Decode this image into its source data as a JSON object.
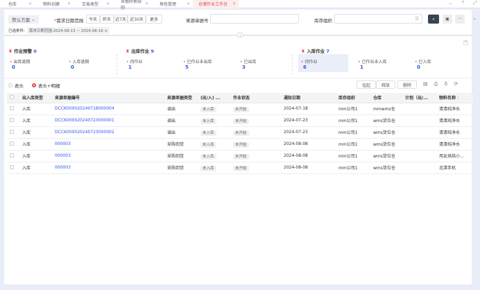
{
  "tabs": [
    {
      "label": "仓库"
    },
    {
      "label": "物料创建"
    },
    {
      "label": "交易类型"
    },
    {
      "label": "单据转换规则"
    },
    {
      "label": "角色管理"
    },
    {
      "label": "仓储作业工作台",
      "active": true
    }
  ],
  "filter": {
    "scheme": "默认方案",
    "date_label": "需求日期范围",
    "quick": [
      "今天",
      "昨天",
      "近7天",
      "近30天",
      "更多"
    ],
    "source_no_label": "来源单据号",
    "source_no_value": "",
    "org_label": "库存组织",
    "org_value": "",
    "selected_label": "已选条件:",
    "selected_tag": "需求日期范围:2024-08-13 ~ 2024-08-16"
  },
  "stats": {
    "warning": {
      "title": "作业预警",
      "count": "0",
      "items": [
        {
          "label": "出库逾期",
          "value": "0"
        },
        {
          "label": "入库逾期",
          "value": "0"
        }
      ]
    },
    "outbound": {
      "title": "出库作业",
      "count": "9",
      "items": [
        {
          "label": "待作业",
          "value": "1"
        },
        {
          "label": "已作业未出库",
          "value": "5"
        },
        {
          "label": "已出库",
          "value": "3"
        }
      ]
    },
    "inbound": {
      "title": "入库作业",
      "count": "7",
      "items": [
        {
          "label": "待作业",
          "value": "6"
        },
        {
          "label": "已作业未入库",
          "value": "1"
        },
        {
          "label": "已入库",
          "value": "0"
        }
      ]
    }
  },
  "view": {
    "options": [
      "表头",
      "表头+明细"
    ],
    "selected": 1
  },
  "actions": {
    "suspend": "挂起",
    "release": "释放",
    "delete": "删除"
  },
  "table": {
    "columns": [
      "出入库类型",
      "来源单据编号",
      "来源单据类型",
      "(出/入) ...",
      "作业状态",
      "通知日期",
      "库存组织",
      "仓库",
      "计划（出/...",
      "物料名称"
    ],
    "rows": [
      [
        "入库",
        "DCCK000020240718000004",
        "调出",
        "未入库",
        "未开始",
        "2024-07-18",
        "mm公司1",
        "mmwms仓",
        "",
        "清清纯净水"
      ],
      [
        "入库",
        "DCCK000020240723000001",
        "调出",
        "未入库",
        "未开始",
        "2024-07-23",
        "mm公司1",
        "wms货位仓",
        "",
        "清清纯净水"
      ],
      [
        "入库",
        "DCCK000020240723000002",
        "调出",
        "未入库",
        "未开始",
        "2024-07-23",
        "mm公司1",
        "wms货位仓",
        "",
        "清清纯净水"
      ],
      [
        "入库",
        "000003",
        "采购到货",
        "未入库",
        "未开始",
        "2024-08-08",
        "mm公司1",
        "wms货位仓",
        "",
        "清清纯净水"
      ],
      [
        "入库",
        "000003",
        "采购到货",
        "未入库",
        "未开始",
        "2024-08-08",
        "mm公司1",
        "wms货位仓",
        "",
        "用友烘焙小..."
      ],
      [
        "入库",
        "000003",
        "采购到货",
        "未入库",
        "未开始",
        "2024-08-08",
        "mm公司1",
        "wms货位仓",
        "",
        "北清手机"
      ]
    ]
  }
}
